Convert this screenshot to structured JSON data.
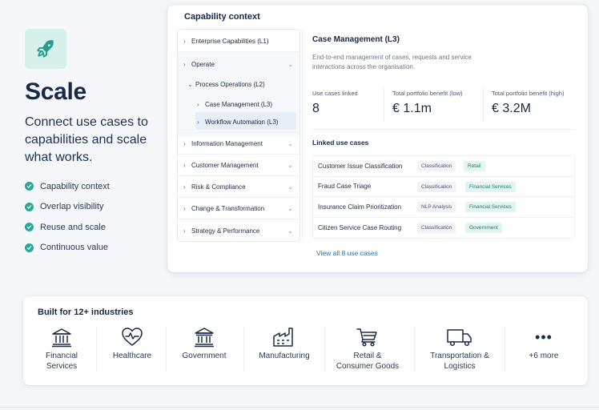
{
  "hero": {
    "icon": "rocket-icon",
    "title": "Scale",
    "subtitle": "Connect use cases to capabilities and scale what works.",
    "features": [
      "Capability context",
      "Overlap visibility",
      "Reuse and scale",
      "Continuous value"
    ]
  },
  "capability": {
    "title": "Capability context",
    "tree": [
      {
        "label": "Enterprise Capabilities (L1)"
      },
      {
        "label": "Operate"
      },
      {
        "label": "Process Operations (L2)"
      },
      {
        "label": "Case Management (L3)"
      },
      {
        "label": "Workflow Automation (L3)"
      },
      {
        "label": "Information Management"
      },
      {
        "label": "Customer Management"
      },
      {
        "label": "Risk & Compliance"
      },
      {
        "label": "Change & Transformation"
      },
      {
        "label": "Strategy & Performance"
      }
    ],
    "detail": {
      "title": "Case Management (L3)",
      "description": "End-to-end management of cases, requests and service interactions across the organisation.",
      "stats": [
        {
          "label": "Use cases linked",
          "value": "8"
        },
        {
          "label": "Total portfolio benefit (low)",
          "value": "€ 1.1m"
        },
        {
          "label": "Total portfolio benefit (high)",
          "value": "€ 3.2M"
        }
      ],
      "linked_title": "Linked use cases",
      "use_cases": [
        {
          "name": "Customer Issue Classification",
          "type": "Classification",
          "industry": "Retail"
        },
        {
          "name": "Fraud Case Triage",
          "type": "Classification",
          "industry": "Financial Services"
        },
        {
          "name": "Insurance Claim Prioritization",
          "type": "NLP Analysis",
          "industry": "Financial Services"
        },
        {
          "name": "Citizen Service Case Routing",
          "type": "Classification",
          "industry": "Government"
        }
      ],
      "view_all": "View all 8 use cases"
    }
  },
  "industries": {
    "title": "Built for 12+ industries",
    "items": [
      {
        "icon": "bank-icon",
        "l1": "Financial",
        "l2": "Services"
      },
      {
        "icon": "heart-pulse-icon",
        "l1": "Healthcare",
        "l2": ""
      },
      {
        "icon": "government-building-icon",
        "l1": "Government",
        "l2": ""
      },
      {
        "icon": "factory-icon",
        "l1": "Manufacturing",
        "l2": ""
      },
      {
        "icon": "shopping-cart-icon",
        "l1": "Retail &",
        "l2": "Consumer Goods"
      },
      {
        "icon": "truck-icon",
        "l1": "Transportation &",
        "l2": "Logistics"
      },
      {
        "icon": "more-icon",
        "l1": "+6 more",
        "l2": ""
      }
    ]
  },
  "colors": {
    "accent": "#27a898",
    "navy": "#17284a",
    "link": "#2a6fa8"
  }
}
